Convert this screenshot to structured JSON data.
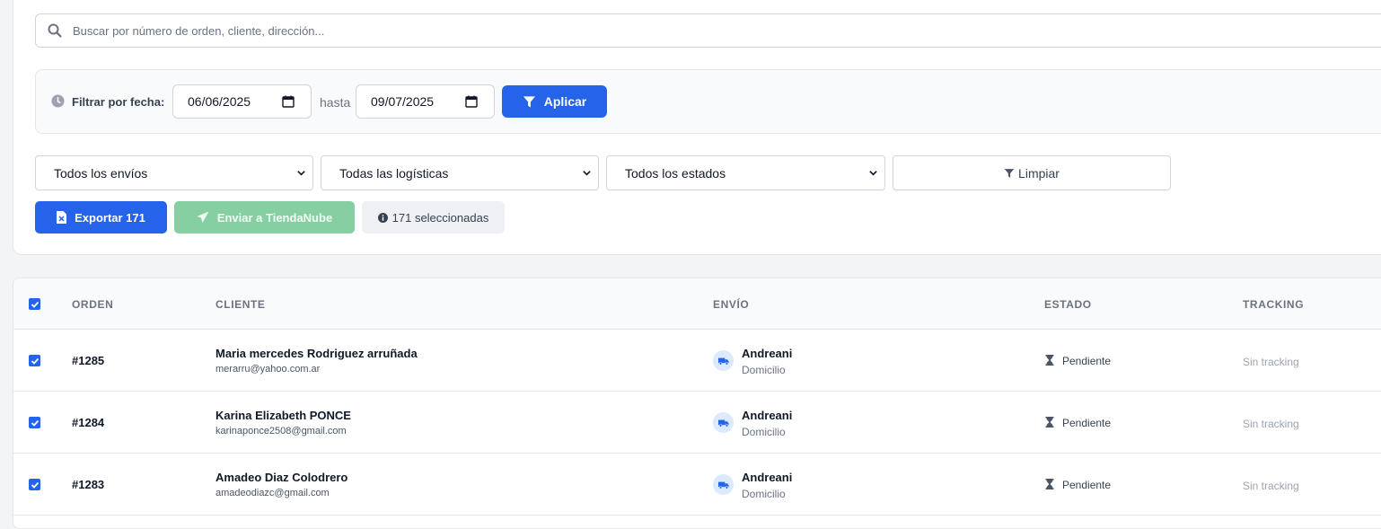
{
  "search": {
    "placeholder": "Buscar por número de orden, cliente, dirección...",
    "icon": "search-icon"
  },
  "date_filter": {
    "label": "Filtrar por fecha:",
    "from": "06/06/2025",
    "separator": "hasta",
    "to": "09/07/2025",
    "apply_label": "Aplicar"
  },
  "filters": {
    "shipments": "Todos los envíos",
    "logistics": "Todas las logísticas",
    "statuses": "Todos los estados",
    "clear_label": "Limpiar"
  },
  "actions": {
    "export_label": "Exportar 171",
    "send_label": "Enviar a TiendaNube",
    "selected_label": "171 seleccionadas"
  },
  "colors": {
    "primary": "#2563eb",
    "success_disabled": "#86cfa3",
    "icon_bg": "#dbeafe"
  },
  "table": {
    "headers": {
      "order": "ORDEN",
      "client": "CLIENTE",
      "shipping": "ENVÍO",
      "status": "ESTADO",
      "tracking": "TRACKING"
    },
    "rows": [
      {
        "order": "#1285",
        "name": "Maria mercedes Rodriguez arruñada",
        "email": "merarru@yahoo.com.ar",
        "carrier": "Andreani",
        "method": "Domicilio",
        "status": "Pendiente",
        "tracking": "Sin tracking"
      },
      {
        "order": "#1284",
        "name": "Karina Elizabeth PONCE",
        "email": "karinaponce2508@gmail.com",
        "carrier": "Andreani",
        "method": "Domicilio",
        "status": "Pendiente",
        "tracking": "Sin tracking"
      },
      {
        "order": "#1283",
        "name": "Amadeo Diaz Colodrero",
        "email": "amadeodiazc@gmail.com",
        "carrier": "Andreani",
        "method": "Domicilio",
        "status": "Pendiente",
        "tracking": "Sin tracking"
      }
    ]
  }
}
